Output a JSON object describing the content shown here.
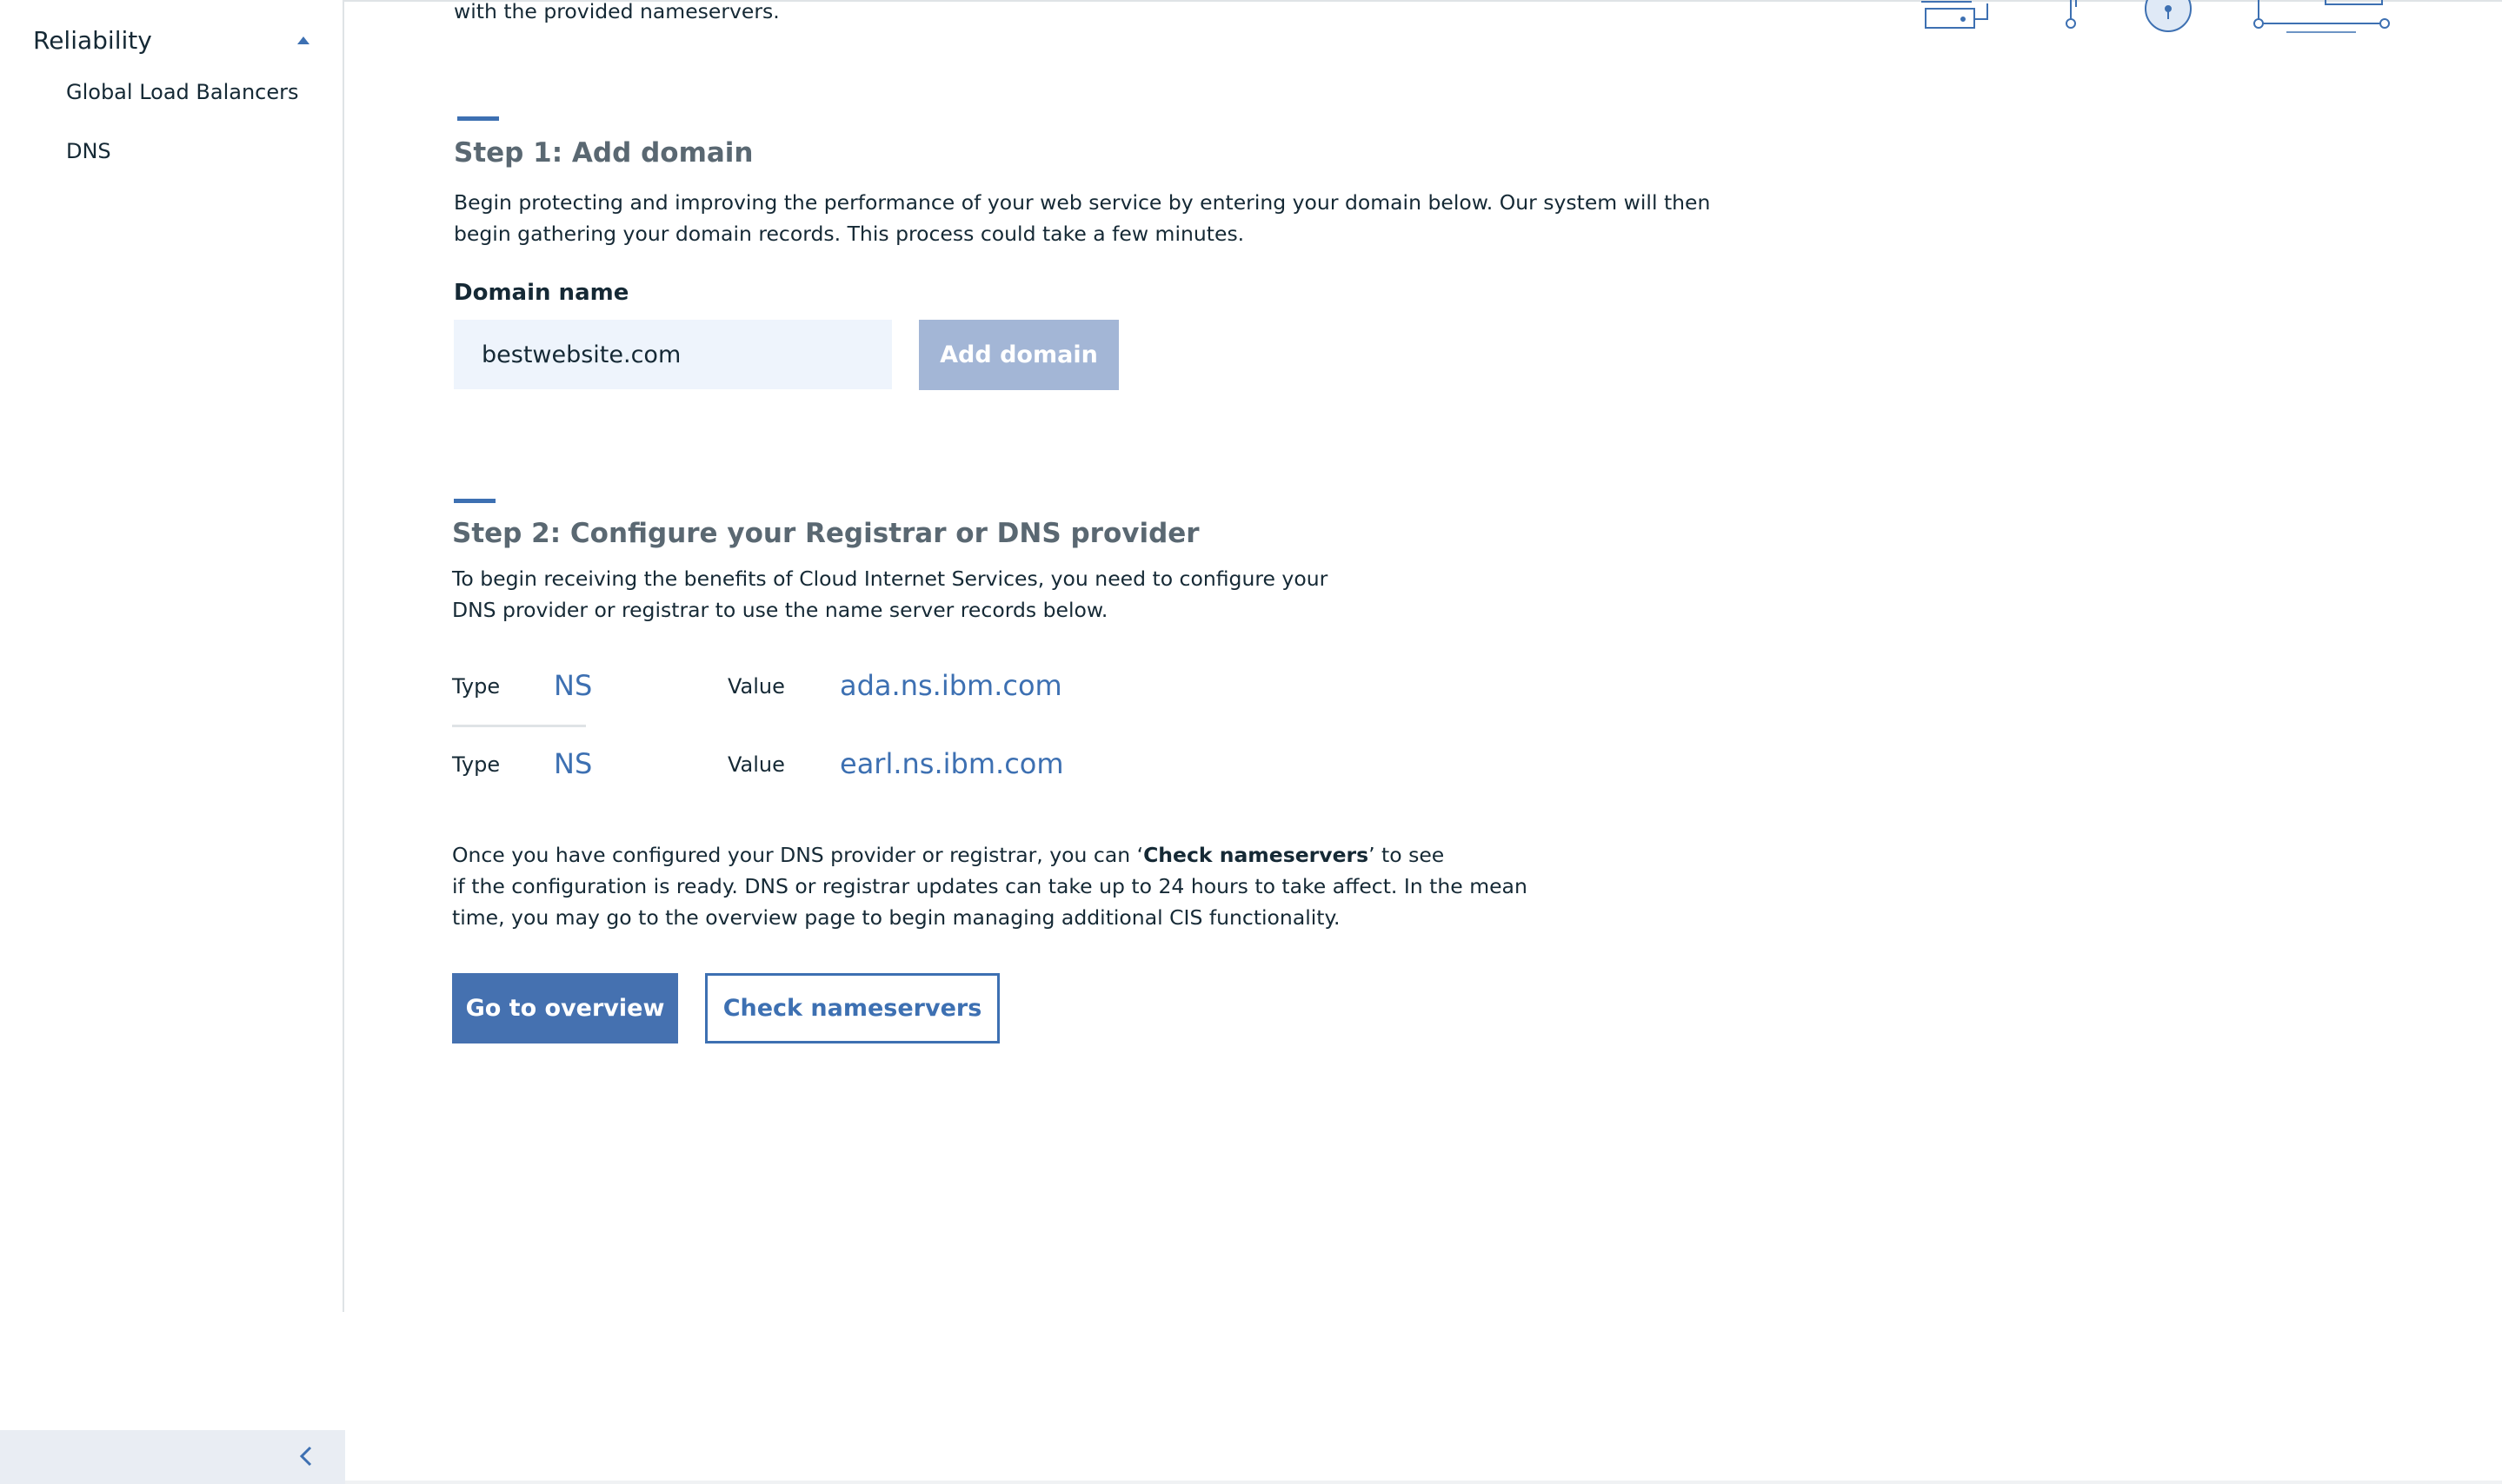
{
  "sidebar": {
    "group_title": "Reliability",
    "items": [
      {
        "label": "Global Load Balancers"
      },
      {
        "label": "DNS"
      }
    ]
  },
  "main": {
    "intro_tail": "with the provided nameservers.",
    "step1": {
      "title": "Step 1: Add domain",
      "desc_line1": "Begin protecting and improving the performance of your web service by entering your domain below. Our system will then",
      "desc_line2": "begin gathering your domain records. This process could take a few minutes.",
      "field_label": "Domain name",
      "field_value": "bestwebsite.com",
      "add_button": "Add domain"
    },
    "step2": {
      "title": "Step 2: Configure your Registrar or DNS provider",
      "desc_line1": "To begin receiving the benefits of Cloud Internet Services, you need to configure your",
      "desc_line2": "DNS provider or registrar to use the name server records below.",
      "records": [
        {
          "type_label": "Type",
          "type": "NS",
          "value_label": "Value",
          "value": "ada.ns.ibm.com"
        },
        {
          "type_label": "Type",
          "type": "NS",
          "value_label": "Value",
          "value": "earl.ns.ibm.com"
        }
      ],
      "note_prefix": "Once you have configured your DNS provider or registrar, you can ‘",
      "note_bold": "Check nameservers",
      "note_suffix": "’ to see",
      "note_line2": "if the configuration is ready. DNS or registrar updates can take up to 24 hours to take affect. In the mean",
      "note_line3": "time, you may go to the overview page to begin managing additional CIS functionality.",
      "overview_button": "Go to overview",
      "check_button": "Check nameservers"
    }
  },
  "colors": {
    "accent": "#3d70b2",
    "primary_button": "#4571b0",
    "disabled_button": "#a3b6d6",
    "input_bg": "#eef4fc"
  },
  "icons": {
    "caret": "caret-up-icon",
    "collapse": "chevron-left-icon",
    "illustration": "network-illustration"
  }
}
